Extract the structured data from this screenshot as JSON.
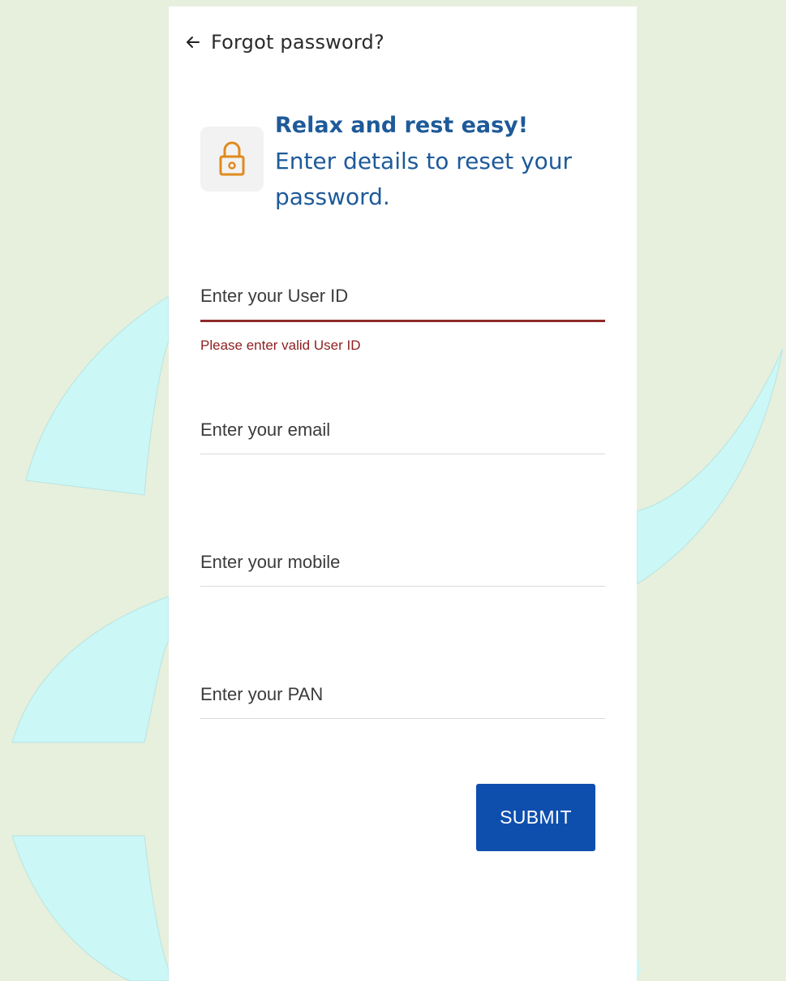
{
  "header": {
    "title": "Forgot password?"
  },
  "hero": {
    "title": "Relax and rest easy!",
    "subtitle": "Enter details to reset your password."
  },
  "form": {
    "user_id": {
      "placeholder": "Enter your User ID",
      "value": "",
      "error": "Please enter valid User ID"
    },
    "email": {
      "placeholder": "Enter your email",
      "value": ""
    },
    "mobile": {
      "placeholder": "Enter your mobile",
      "value": ""
    },
    "pan": {
      "placeholder": "Enter your PAN",
      "value": ""
    }
  },
  "submit_label": "SUBMIT",
  "icons": {
    "back": "arrow-left-icon",
    "lock": "lock-icon"
  },
  "colors": {
    "background": "#e7f0dd",
    "accent_blue": "#0e4fae",
    "hero_text": "#1e5a99",
    "lock_orange": "#e08a1e",
    "error_red": "#8e1f1f",
    "decor_cyan": "#ccf7f7"
  }
}
